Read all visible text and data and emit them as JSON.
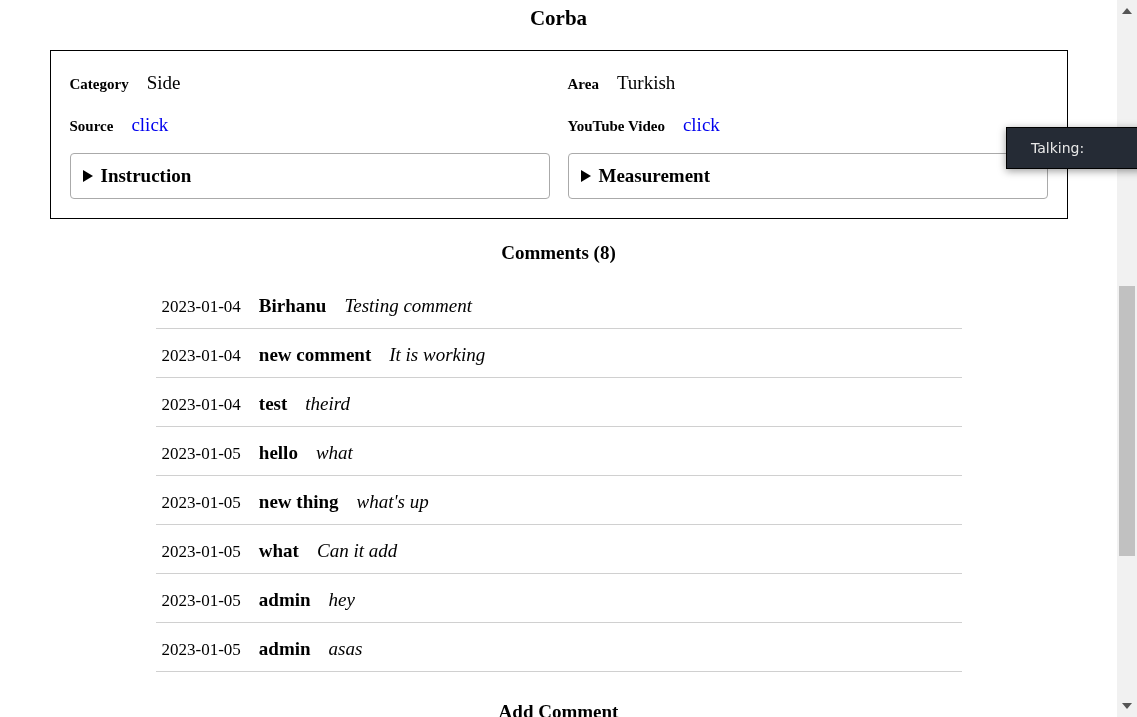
{
  "title": "Corba",
  "details": [
    {
      "label": "Category",
      "value": "Side",
      "kind": "text"
    },
    {
      "label": "Area",
      "value": "Turkish",
      "kind": "text"
    },
    {
      "label": "Source",
      "value": "click",
      "kind": "link"
    },
    {
      "label": "YouTube Video",
      "value": "click",
      "kind": "link"
    }
  ],
  "sections": [
    {
      "label": "Instruction",
      "expanded": false
    },
    {
      "label": "Measurement",
      "expanded": false
    }
  ],
  "comments_heading": "Comments (8)",
  "comments": [
    {
      "date": "2023-01-04",
      "author": "Birhanu",
      "text": "Testing comment"
    },
    {
      "date": "2023-01-04",
      "author": "new comment",
      "text": "It is working"
    },
    {
      "date": "2023-01-04",
      "author": "test",
      "text": "theird"
    },
    {
      "date": "2023-01-05",
      "author": "hello",
      "text": "what"
    },
    {
      "date": "2023-01-05",
      "author": "new thing",
      "text": "what's up"
    },
    {
      "date": "2023-01-05",
      "author": "what",
      "text": "Can it add"
    },
    {
      "date": "2023-01-05",
      "author": "admin",
      "text": "hey"
    },
    {
      "date": "2023-01-05",
      "author": "admin",
      "text": "asas"
    }
  ],
  "add_comment_heading": "Add Comment",
  "tooltip": "Talking:"
}
